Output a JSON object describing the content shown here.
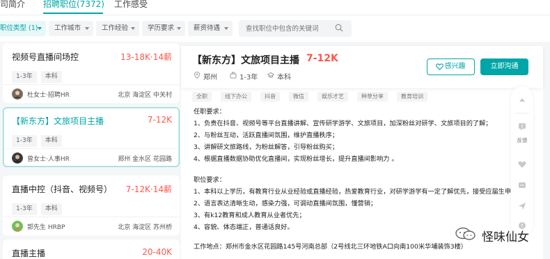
{
  "tabs": [
    {
      "label": "公司简介",
      "active": false
    },
    {
      "label": "招聘职位(7372)",
      "active": true
    },
    {
      "label": "工作感受",
      "active": false
    }
  ],
  "filters": {
    "chips": [
      "职位类型 (1)",
      "工作城市",
      "工作经验",
      "学历要求",
      "薪资待遇"
    ],
    "search_placeholder": "查找职位中包含的关键词"
  },
  "jobs": [
    {
      "title": "视频号直播间场控",
      "salary": "13-18K·14薪",
      "tags": [
        "1-3年",
        "本科"
      ],
      "hr": "杜女士·招聘HR",
      "location": "北京 海淀区 中关村"
    },
    {
      "title": "【新东方】文旅项目主播",
      "salary": "7-12K",
      "tags": [
        "1-3年",
        "本科"
      ],
      "hr": "曾女士·人事HR",
      "location": "郑州 金水区 花园路"
    },
    {
      "title": "直播中控（抖音、视频号）",
      "salary": "7-12K·14薪",
      "tags": [
        "1-3年",
        "本科"
      ],
      "hr": "郭先生 HRBP",
      "location": "北京 海淀区 苏州桥"
    },
    {
      "title": "直播主播",
      "salary": "20-40K"
    }
  ],
  "detail": {
    "title": "【新东方】文旅项目主播",
    "salary": "7-12K",
    "city": "郑州",
    "experience": "1-3年",
    "education": "本科",
    "interest_label": "感兴趣",
    "chat_label": "立即沟通",
    "benefits": [
      "全职",
      "线下办公",
      "抖音",
      "微信",
      "娱乐才艺",
      "种草分享",
      "教育培训"
    ],
    "lines": [
      "任职要求：",
      "1、负责在抖音、视频号等平台直播讲解、宣传研学游学、文旅项目，加深粉丝对研学、文旅项目的了解；",
      "2、与粉丝互动，活跃直播间氛围，维护直播秩序；",
      "3、讲解研文旅路线，为粉丝解答，引导粉丝购买；",
      "4、根据直播数据协助优化直播间，实现粉丝增长，提升直播间影响力 。",
      "",
      "职位要求：",
      "1、本科以上学历，有教育行业从业经验或直播经验，热爱教育行业，对研学游学有一定了解优先，接受应届生申",
      "2、语言表达清晰生动，感染力强，可调动直播间氛围，懂营销；",
      "3、有k12教育和成人教育从业者优先；",
      "4、容貌、体态端正，普通话良好。",
      "",
      "工作地点：郑州市金水区花园路145号河南总部（2号线北三环地铁A口向南100米华埔装饰3楼）"
    ]
  },
  "floatbar": {
    "feedback_label": "反馈"
  },
  "watermark": {
    "text": "怪味仙女"
  },
  "colors": {
    "accent": "#00a6a7",
    "salary": "#fe574a"
  }
}
